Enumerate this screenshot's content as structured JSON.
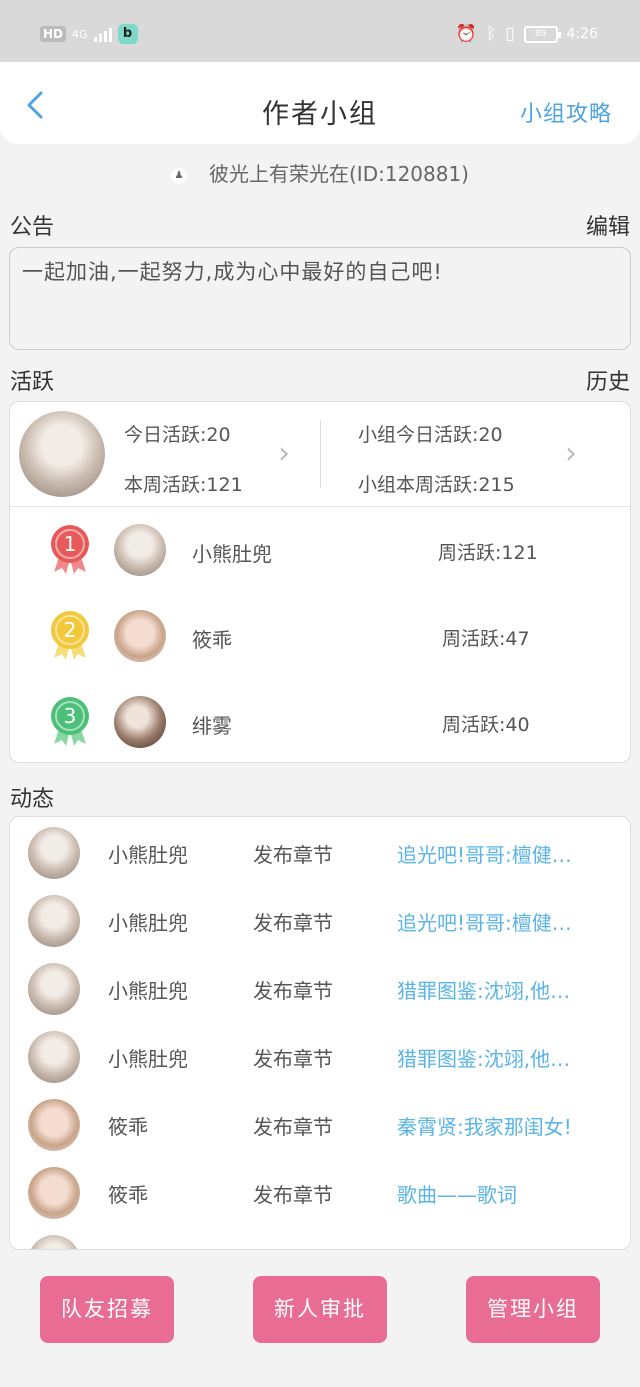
{
  "status_bar": {
    "hd": "HD",
    "network": "4G",
    "app_badge": "b",
    "battery": "89",
    "time": "4:26",
    "icons": [
      "alarm-icon",
      "bluetooth-icon",
      "vibrate-icon"
    ]
  },
  "header": {
    "title": "作者小组",
    "right_link": "小组攻略"
  },
  "owner": "彼光上有荣光在(ID:120881)",
  "notice": {
    "label": "公告",
    "action": "编辑",
    "text": "一起加油,一起努力,成为心中最好的自己吧!"
  },
  "activity": {
    "label": "活跃",
    "action": "历史",
    "today": "今日活跃:20",
    "week": "本周活跃:121",
    "group_today": "小组今日活跃:20",
    "group_week": "小组本周活跃:215",
    "ranking": [
      {
        "rank": "1",
        "name": "小熊肚兜",
        "value": "周活跃:121",
        "color": "#e85a5a",
        "ribbon": "#f08a8a"
      },
      {
        "rank": "2",
        "name": "筱乖",
        "value": "周活跃:47",
        "color": "#f2c93a",
        "ribbon": "#f6dc7a"
      },
      {
        "rank": "3",
        "name": "绯雾",
        "value": "周活跃:40",
        "color": "#4cc07a",
        "ribbon": "#86d9a2"
      }
    ]
  },
  "feed": {
    "label": "动态",
    "items": [
      {
        "name": "小熊肚兜",
        "action": "发布章节",
        "link": "追光吧!哥哥:檀健…"
      },
      {
        "name": "小熊肚兜",
        "action": "发布章节",
        "link": "追光吧!哥哥:檀健…"
      },
      {
        "name": "小熊肚兜",
        "action": "发布章节",
        "link": "猎罪图鉴:沈翊,他…"
      },
      {
        "name": "小熊肚兜",
        "action": "发布章节",
        "link": "猎罪图鉴:沈翊,他…"
      },
      {
        "name": "筱乖",
        "action": "发布章节",
        "link": "秦霄贤:我家那闺女!"
      },
      {
        "name": "筱乖",
        "action": "发布章节",
        "link": "歌曲——歌词"
      }
    ]
  },
  "buttons": {
    "recruit": "队友招募",
    "approve": "新人审批",
    "manage": "管理小组"
  },
  "colors": {
    "accent_blue": "#4fa3e0",
    "link_blue": "#5ab4e6",
    "button_pink": "#e86c93"
  }
}
